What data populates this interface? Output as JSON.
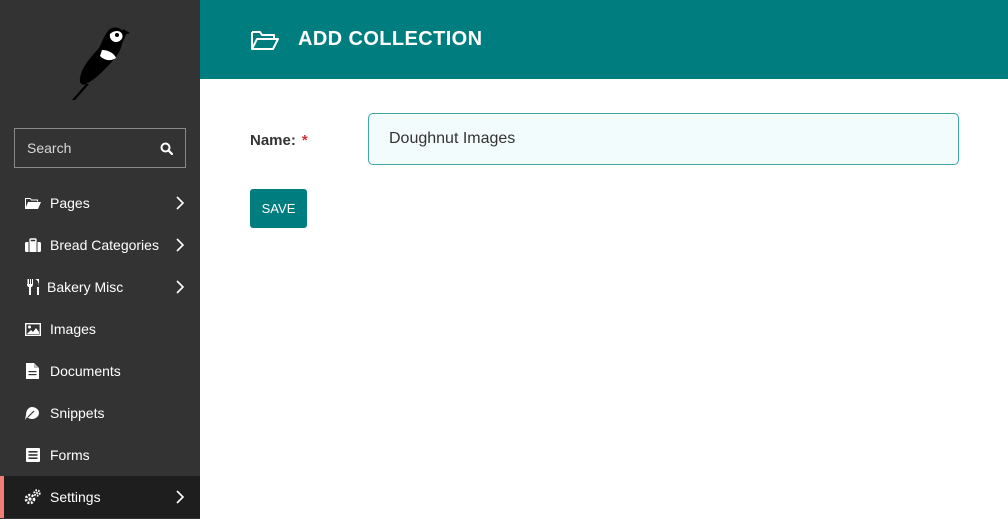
{
  "sidebar": {
    "logo": "wagtail-bird-logo",
    "search": {
      "placeholder": "Search",
      "icon": "search-icon"
    },
    "items": [
      {
        "label": "Pages",
        "icon": "folder-open-icon",
        "has_submenu": true
      },
      {
        "label": "Bread Categories",
        "icon": "suitcase-icon",
        "has_submenu": true
      },
      {
        "label": "Bakery Misc",
        "icon": "utensils-icon",
        "has_submenu": true
      },
      {
        "label": "Images",
        "icon": "image-icon",
        "has_submenu": false
      },
      {
        "label": "Documents",
        "icon": "document-icon",
        "has_submenu": false
      },
      {
        "label": "Snippets",
        "icon": "snippet-icon",
        "has_submenu": false
      },
      {
        "label": "Forms",
        "icon": "form-icon",
        "has_submenu": false
      },
      {
        "label": "Settings",
        "icon": "cogs-icon",
        "has_submenu": true,
        "active": true
      }
    ]
  },
  "header": {
    "title": "ADD COLLECTION",
    "icon": "folder-open-icon"
  },
  "form": {
    "name_label": "Name:",
    "required_marker": "*",
    "name_value": "Doughnut Images",
    "save_label": "SAVE"
  },
  "colors": {
    "sidebar_bg": "#333333",
    "header_bg": "#007d7e",
    "active_indicator": "#f37e77",
    "required": "#cd3238"
  }
}
